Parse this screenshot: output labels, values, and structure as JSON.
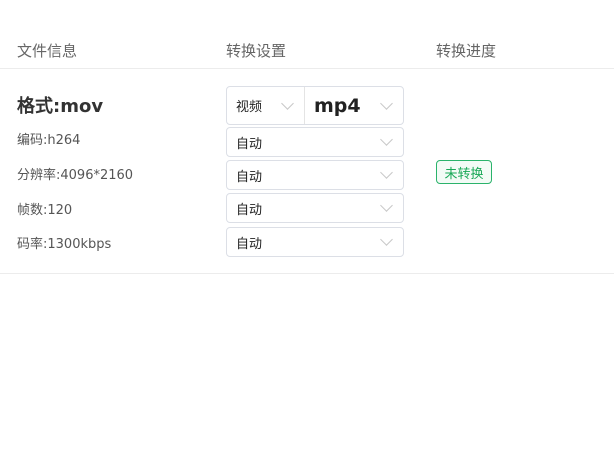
{
  "headers": {
    "file_info": "文件信息",
    "settings": "转换设置",
    "progress": "转换进度"
  },
  "file": {
    "format": "格式:mov",
    "codec": "编码:h264",
    "resolution": "分辨率:4096*2160",
    "fps": "帧数:120",
    "bitrate": "码率:1300kbps"
  },
  "settings": {
    "type": "视频",
    "container": "mp4",
    "codec": "自动",
    "resolution": "自动",
    "fps": "自动",
    "bitrate": "自动"
  },
  "status": "未转换"
}
